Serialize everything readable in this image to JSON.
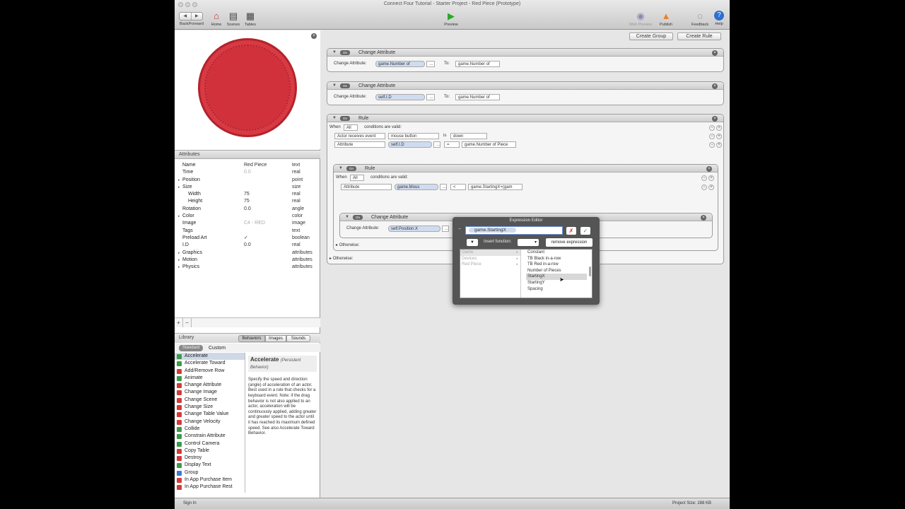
{
  "window": {
    "title": "Connect Four Tutorial - Starter Project - Red Piece (Prototype)"
  },
  "toolbar": {
    "back_forward": "Back/Forward",
    "home": "Home",
    "scenes": "Scenes",
    "tables": "Tables",
    "preview": "Preview",
    "web_preview": "Web Preview",
    "publish": "Publish",
    "feedback": "Feedback",
    "help": "Help"
  },
  "attributes": {
    "header": "Attributes",
    "rows": [
      {
        "name": "Name",
        "value": "Red Piece",
        "type": "text",
        "indent": 0,
        "expand": false
      },
      {
        "name": "Time",
        "value": "0.0",
        "type": "real",
        "indent": 0,
        "expand": false
      },
      {
        "name": "Position",
        "value": "",
        "type": "point",
        "indent": 0,
        "expand": true
      },
      {
        "name": "Size",
        "value": "",
        "type": "size",
        "indent": 0,
        "expand": true
      },
      {
        "name": "Width",
        "value": "75",
        "type": "real",
        "indent": 1,
        "expand": false
      },
      {
        "name": "Height",
        "value": "75",
        "type": "real",
        "indent": 1,
        "expand": false
      },
      {
        "name": "Rotation",
        "value": "0.0",
        "type": "angle",
        "indent": 0,
        "expand": false
      },
      {
        "name": "Color",
        "value": "",
        "type": "color",
        "indent": 0,
        "expand": true
      },
      {
        "name": "Image",
        "value": "C4 - RED",
        "type": "image",
        "indent": 0,
        "expand": false
      },
      {
        "name": "Tags",
        "value": "",
        "type": "text",
        "indent": 0,
        "expand": false
      },
      {
        "name": "Preload Art",
        "value": "✓",
        "type": "boolean",
        "indent": 0,
        "expand": false
      },
      {
        "name": "I.D",
        "value": "0.0",
        "type": "real",
        "indent": 0,
        "expand": false
      },
      {
        "name": "Graphics",
        "value": "",
        "type": "attributes",
        "indent": 0,
        "expand": true
      },
      {
        "name": "Motion",
        "value": "",
        "type": "attributes",
        "indent": 0,
        "expand": true
      },
      {
        "name": "Physics",
        "value": "",
        "type": "attributes",
        "indent": 0,
        "expand": true
      }
    ]
  },
  "library": {
    "header": "Library",
    "tabs": [
      "Behaviors",
      "Images",
      "Sounds"
    ],
    "subtabs": [
      "Standard",
      "Custom"
    ],
    "items": [
      {
        "label": "Accelerate",
        "color": "#3a9a4a"
      },
      {
        "label": "Accelerate Toward",
        "color": "#3a9a4a"
      },
      {
        "label": "Add/Remove Row",
        "color": "#d23a3a"
      },
      {
        "label": "Animate",
        "color": "#3a9a4a"
      },
      {
        "label": "Change Attribute",
        "color": "#d23a3a"
      },
      {
        "label": "Change Image",
        "color": "#d23a3a"
      },
      {
        "label": "Change Scene",
        "color": "#d23a3a"
      },
      {
        "label": "Change Size",
        "color": "#d23a3a"
      },
      {
        "label": "Change Table Value",
        "color": "#d23a3a"
      },
      {
        "label": "Change Velocity",
        "color": "#d23a3a"
      },
      {
        "label": "Collide",
        "color": "#3a9a4a"
      },
      {
        "label": "Constrain Attribute",
        "color": "#3a9a4a"
      },
      {
        "label": "Control Camera",
        "color": "#3a9a4a"
      },
      {
        "label": "Copy Table",
        "color": "#d23a3a"
      },
      {
        "label": "Destroy",
        "color": "#d23a3a"
      },
      {
        "label": "Display Text",
        "color": "#3a9a4a"
      },
      {
        "label": "Group",
        "color": "#3a7ad2"
      },
      {
        "label": "In App Purchase Item",
        "color": "#d23a3a"
      },
      {
        "label": "In App Purchase Rest",
        "color": "#d23a3a"
      }
    ],
    "description": {
      "title": "Accelerate",
      "subtitle": "(Persistent Behavior)",
      "body": "Specify the speed and direction (angle) of acceleration of an actor. Best used in a rule that checks for a keyboard event. Note: if the drag behavior is not also applied to an actor, acceleration will be continuously applied, adding greater and greater speed to the actor until it has reached its maximum defined speed. See also Accelerate Toward Behavior."
    }
  },
  "main": {
    "create_group": "Create Group",
    "create_rule": "Create Rule",
    "on": "On",
    "change1": {
      "title": "Change Attribute",
      "label": "Change Attribute:",
      "attr": "game.Number of",
      "to": "To:",
      "value": "game.Number of"
    },
    "change2": {
      "title": "Change Attribute",
      "label": "Change Attribute:",
      "attr": "self.I.D",
      "to": "To:",
      "value": "game.Number of"
    },
    "rule1": {
      "title": "Rule",
      "when": "When",
      "all": "All",
      "cond": "conditions are valid:",
      "c1a": "Actor receives event",
      "c1b": "mouse button",
      "c1c": "is",
      "c1d": "down",
      "c2a": "Attribute",
      "c2b": "self.I.D",
      "c2c": "=",
      "c2d": "game.Number of Piece",
      "otherwise": "Otherwise:"
    },
    "rule2": {
      "title": "Rule",
      "when": "When",
      "all": "All",
      "cond": "conditions are valid:",
      "c1a": "Attribute",
      "c1b": "game.Mous",
      "c1c": "<",
      "c1d": "game.StartingX+(gam",
      "otherwise": "Otherwise:"
    },
    "change3": {
      "title": "Change Attribute",
      "label": "Change Attribute:",
      "attr": "self.Position.X"
    }
  },
  "expression_editor": {
    "title": "Expression Editor",
    "expression": "game.StartingX",
    "insert_function": "Insert function:",
    "remove_expression": "remove expression",
    "categories": [
      "Game",
      "Devices",
      "Red Piece"
    ],
    "attrs": [
      "Constant",
      "TB Black in-a-row",
      "TB Red in-a-row",
      "Number of Pieces",
      "StartingX",
      "StartingY",
      "Spacing"
    ],
    "selected": "StartingX"
  },
  "footer": {
    "sign_in": "Sign In",
    "project_size": "Project Size: 288 KB"
  }
}
